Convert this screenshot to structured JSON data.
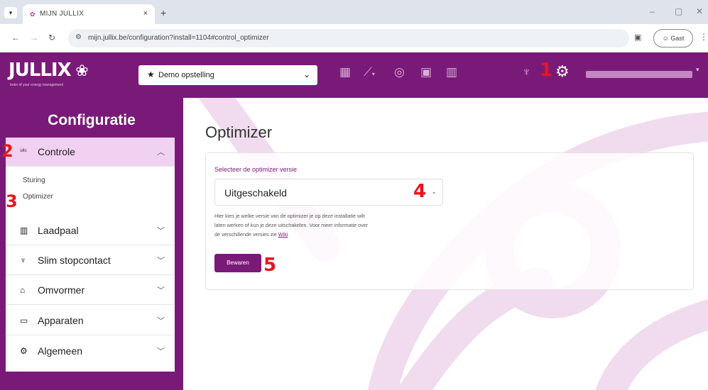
{
  "browser": {
    "tab_title": "MIJN JULLIX",
    "tab_close": "×",
    "new_tab": "+",
    "url": "mijn.jullix.be/configuration?install=1104#control_optimizer",
    "guest_label": "Gast",
    "window_controls": [
      "–",
      "▢",
      "✕"
    ]
  },
  "header": {
    "logo_text": "JULLIX",
    "tagline": "brain of your energy management",
    "installation": {
      "label": "Demo opstelling",
      "star": "★"
    },
    "icons": [
      "dashboard-icon",
      "chart-icon",
      "brain-icon",
      "battery-icon",
      "charger-icon",
      "plug-icon",
      "gear-icon"
    ]
  },
  "sidebar": {
    "title": "Configuratie",
    "sections": [
      {
        "label": "Controle",
        "icon": "controle-icon",
        "expanded": true,
        "items": [
          "Sturing",
          "Optimizer"
        ]
      },
      {
        "label": "Laadpaal",
        "icon": "charger-icon",
        "expanded": false
      },
      {
        "label": "Slim stopcontact",
        "icon": "plug-icon",
        "expanded": false
      },
      {
        "label": "Omvormer",
        "icon": "inverter-icon",
        "expanded": false
      },
      {
        "label": "Apparaten",
        "icon": "devices-icon",
        "expanded": false
      },
      {
        "label": "Algemeen",
        "icon": "gear-icon",
        "expanded": false
      }
    ]
  },
  "main": {
    "title": "Optimizer",
    "field_label": "Selecteer de optimizer versie",
    "select_value": "Uitgeschakeld",
    "help_line1": "Hier kies je welke versie van de optimizer je op deze installatie wilt",
    "help_line2": "laten werken of kun je deze uitschakelen. Voor meer informatie over",
    "help_line3": "de verschillende versies zie",
    "help_link": "Wiki",
    "save_label": "Bewaren"
  },
  "annotations": [
    "1",
    "2",
    "3",
    "4",
    "5"
  ],
  "colors": {
    "brand": "#7a1a78",
    "active_bg": "#f1d1f2",
    "annotation": "#e8141c"
  }
}
